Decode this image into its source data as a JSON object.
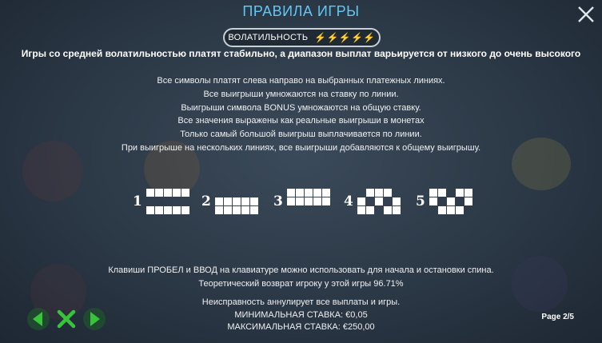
{
  "title": "ПРАВИЛА ИГРЫ",
  "volatility": {
    "label": "ВОЛАТИЛЬНОСТЬ",
    "level": 3,
    "max": 5,
    "active_color": "#f5c400",
    "inactive_color": "#cfd5da"
  },
  "volatility_desc": "Игры со средней волатильностью платят стабильно, а диапазон выплат варьируется от низкого до очень высокого",
  "rules": [
    "Все символы платят слева направо на выбранных платежных линиях.",
    "Все выигрыши умножаются на ставку по линии.",
    "Выигрыши символа BONUS умножаются на общую ставку.",
    "Все значения выражены как реальные выигрыши в монетах",
    "Только самый большой выигрыш выплачивается по линии.",
    "При выигрыше на нескольких линиях, все выигрыши добавляются к общему выигрышу."
  ],
  "paylines": [
    {
      "number": "1",
      "pattern": [
        [
          0,
          0,
          0,
          0,
          0
        ],
        [
          1,
          1,
          1,
          1,
          1
        ],
        [
          0,
          0,
          0,
          0,
          0
        ]
      ]
    },
    {
      "number": "2",
      "pattern": [
        [
          1,
          1,
          1,
          1,
          1
        ],
        [
          0,
          0,
          0,
          0,
          0
        ],
        [
          0,
          0,
          0,
          0,
          0
        ]
      ]
    },
    {
      "number": "3",
      "pattern": [
        [
          0,
          0,
          0,
          0,
          0
        ],
        [
          0,
          0,
          0,
          0,
          0
        ],
        [
          1,
          1,
          1,
          1,
          1
        ]
      ]
    },
    {
      "number": "4",
      "pattern": [
        [
          1,
          0,
          0,
          0,
          1
        ],
        [
          0,
          1,
          0,
          1,
          0
        ],
        [
          0,
          0,
          1,
          0,
          0
        ]
      ]
    },
    {
      "number": "5",
      "pattern": [
        [
          0,
          0,
          1,
          0,
          0
        ],
        [
          0,
          1,
          0,
          1,
          0
        ],
        [
          1,
          0,
          0,
          0,
          1
        ]
      ]
    }
  ],
  "info": [
    "Клавиши ПРОБЕЛ и ВВОД на клавиатуре можно использовать для начала и остановки спина.",
    "Теоретический возврат игроку у этой игры  96.71%"
  ],
  "bottom": [
    "Неисправность аннулирует все выплаты и игры.",
    "МИНИМАЛЬНАЯ СТАВКА: €0,05",
    "МАКСИМАЛЬНАЯ СТАВКА: €250,00"
  ],
  "page": "Page 2/5",
  "colors": {
    "accent": "#5fc8f5",
    "nav_green": "#38c43a"
  }
}
